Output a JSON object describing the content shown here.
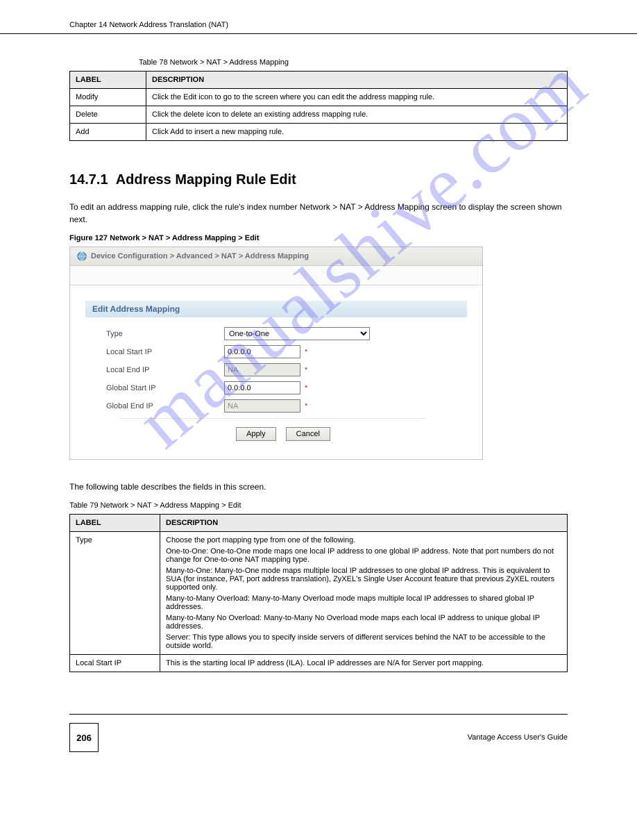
{
  "header": {
    "chapter": "Chapter 14 Network Address Translation (NAT)",
    "usage_note": "Vantage Access User's Guide"
  },
  "table_top": {
    "caption": "Table 78   Network > NAT > Address Mapping",
    "col1": "LABEL",
    "col2": "DESCRIPTION",
    "rows": [
      {
        "label": "Modify",
        "desc": "Click the Edit icon to go to the screen where you can edit the address mapping rule."
      },
      {
        "label": "Delete",
        "desc": "Click the delete icon to delete an existing address mapping rule."
      },
      {
        "label": "Add",
        "desc": "Click Add to insert a new mapping rule."
      }
    ]
  },
  "section": {
    "number": "14.7.1",
    "title": "Address Mapping Rule Edit",
    "intro": "To edit an address mapping rule, click the rule's index number Network > NAT > Address Mapping screen to display the screen shown next."
  },
  "figure": {
    "label": "Figure 127   Network > NAT > Address Mapping > Edit"
  },
  "screenshot": {
    "breadcrumb": "Device Configuration > Advanced > NAT > Address Mapping",
    "panel_title": "Edit Address Mapping",
    "fields": {
      "type_label": "Type",
      "type_value": "One-to-One",
      "local_start_label": "Local Start IP",
      "local_start_value": "0.0.0.0",
      "local_end_label": "Local End IP",
      "local_end_value": "NA",
      "global_start_label": "Global Start IP",
      "global_start_value": "0.0.0.0",
      "global_end_label": "Global End IP",
      "global_end_value": "NA"
    },
    "buttons": {
      "apply": "Apply",
      "cancel": "Cancel"
    }
  },
  "table_bottom": {
    "caption_lead": "The following table describes the fields in this screen.",
    "caption": "Table 79   Network > NAT > Address Mapping > Edit",
    "col1": "LABEL",
    "col2": "DESCRIPTION",
    "rows": [
      {
        "label": "Type",
        "desc_lines": [
          "Choose the port mapping type from one of the following.",
          "One-to-One: One-to-One mode maps one local IP address to one global IP address. Note that port numbers do not change for One-to-one NAT mapping type.",
          "Many-to-One: Many-to-One mode maps multiple local IP addresses to one global IP address. This is equivalent to SUA (for instance, PAT, port address translation), ZyXEL's Single User Account feature that previous ZyXEL routers supported only.",
          "Many-to-Many Overload: Many-to-Many Overload mode maps multiple local IP addresses to shared global IP addresses.",
          "Many-to-Many No Overload: Many-to-Many No Overload mode maps each local IP address to unique global IP addresses.",
          "Server: This type allows you to specify inside servers of different services behind the NAT to be accessible to the outside world."
        ]
      },
      {
        "label": "Local Start IP",
        "desc_lines": [
          "This is the starting local IP address (ILA). Local IP addresses are N/A for Server port mapping."
        ]
      }
    ]
  },
  "footer": {
    "page_number": "206",
    "guide": "Vantage Access User's Guide"
  },
  "watermark": "manualshive.com"
}
